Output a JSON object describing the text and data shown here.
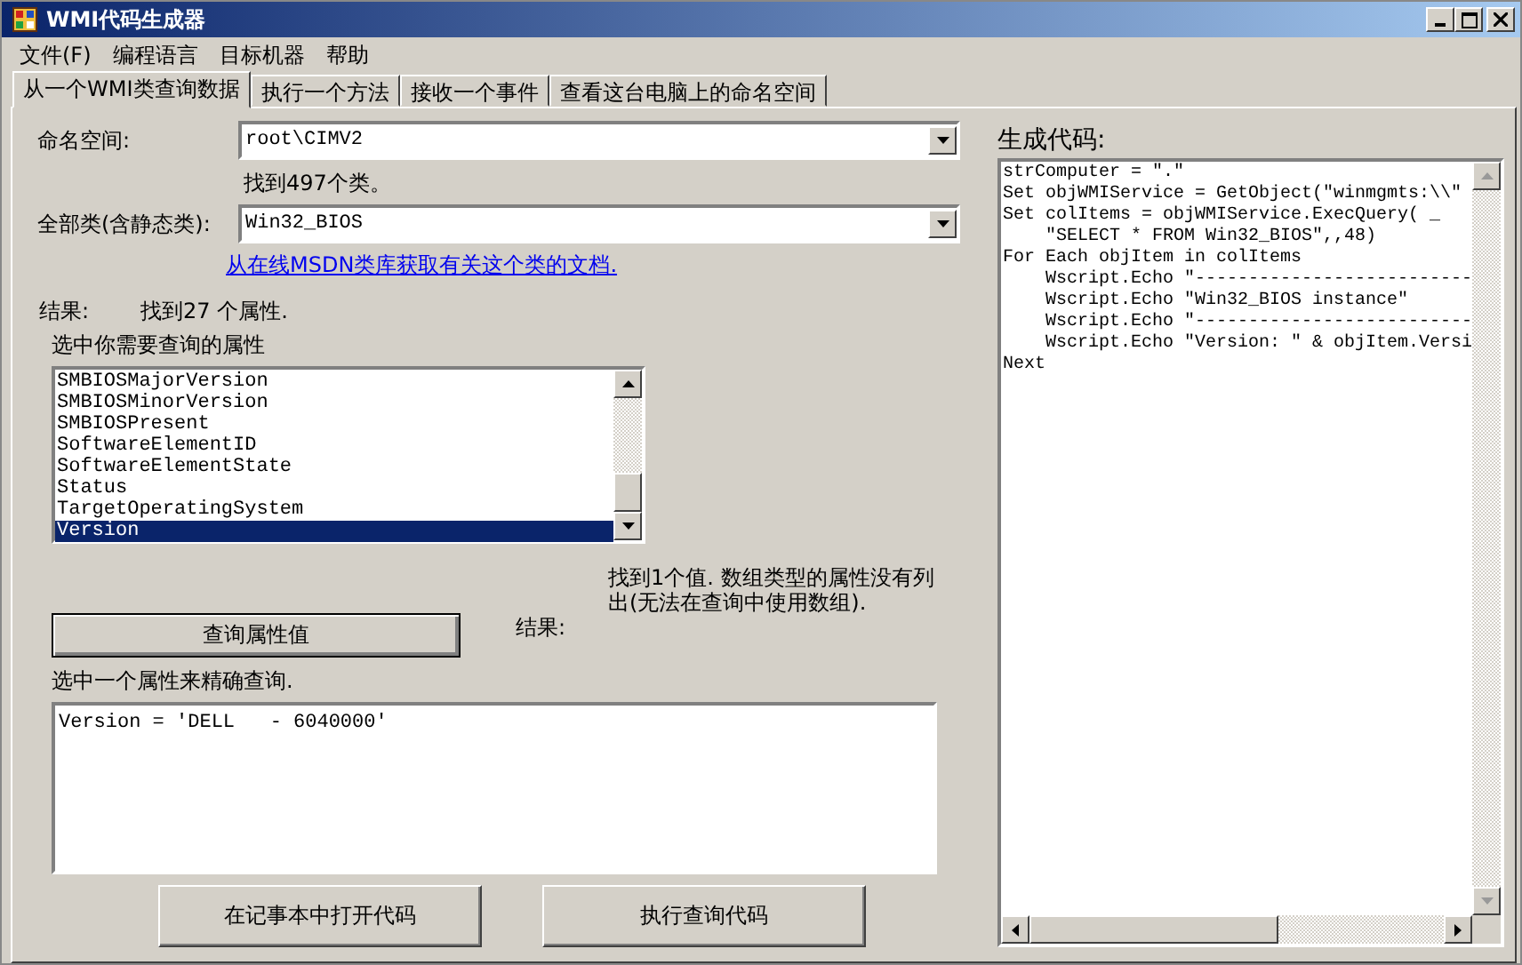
{
  "window": {
    "title": "WMI代码生成器"
  },
  "menu": [
    "文件(F)",
    "编程语言",
    "目标机器",
    "帮助"
  ],
  "tabs": [
    {
      "label": "从一个WMI类查询数据",
      "selected": true
    },
    {
      "label": "执行一个方法",
      "selected": false
    },
    {
      "label": "接收一个事件",
      "selected": false
    },
    {
      "label": "查看这台电脑上的命名空间",
      "selected": false
    }
  ],
  "query": {
    "namespace_label": "命名空间:",
    "namespace_value": "root\\CIMV2",
    "classes_found": "找到497个类。",
    "class_label": "全部类(含静态类):",
    "class_value": "Win32_BIOS",
    "msdn_link": "从在线MSDN类库获取有关这个类的文档.",
    "results_label": "结果:",
    "results_value": "找到27 个属性.",
    "properties_label": "选中你需要查询的属性",
    "properties": [
      {
        "name": "SMBIOSMajorVersion",
        "selected": false
      },
      {
        "name": "SMBIOSMinorVersion",
        "selected": false
      },
      {
        "name": "SMBIOSPresent",
        "selected": false
      },
      {
        "name": "SoftwareElementID",
        "selected": false
      },
      {
        "name": "SoftwareElementState",
        "selected": false
      },
      {
        "name": "Status",
        "selected": false
      },
      {
        "name": "TargetOperatingSystem",
        "selected": false
      },
      {
        "name": "Version",
        "selected": true
      }
    ],
    "values_note": "找到1个值. 数组类型的属性没有列出(无法在查询中使用数组).",
    "values_label": "结果:",
    "query_button": "查询属性值",
    "filter_label": "选中一个属性来精确查询.",
    "filter_value": "Version = 'DELL   - 6040000'",
    "buttons": [
      "在记事本中打开代码",
      "执行查询代码"
    ]
  },
  "code": {
    "label": "生成代码:",
    "lines": [
      "strComputer = \".\"",
      "Set objWMIService = GetObject(\"winmgmts:\\\\\"",
      "Set colItems = objWMIService.ExecQuery( _",
      "    \"SELECT * FROM Win32_BIOS\",,48)",
      "For Each objItem in colItems",
      "    Wscript.Echo \"--------------------------",
      "    Wscript.Echo \"Win32_BIOS instance\"",
      "    Wscript.Echo \"--------------------------",
      "    Wscript.Echo \"Version: \" & objItem.Versi",
      "Next"
    ]
  }
}
